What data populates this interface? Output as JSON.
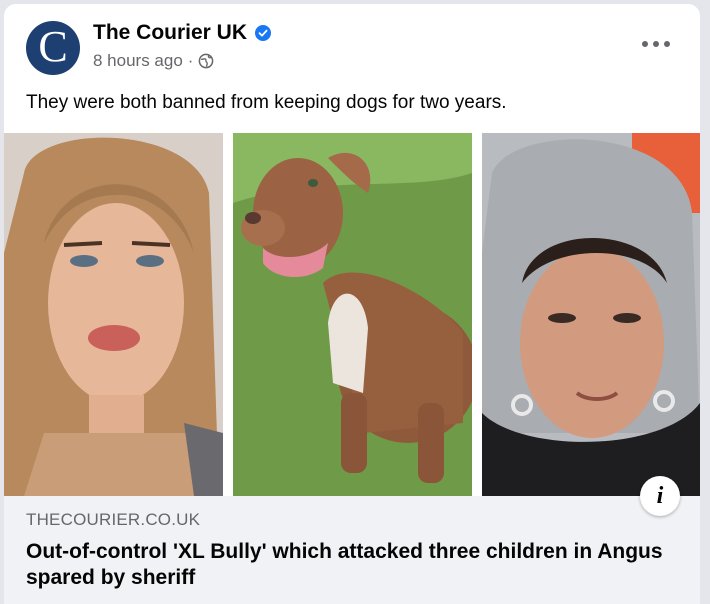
{
  "post": {
    "page_name": "The Courier UK",
    "avatar_letter": "C",
    "verified": true,
    "time": "8 hours ago",
    "separator": "·",
    "audience_icon": "globe-icon",
    "more_icon": "more-options-icon",
    "caption": "They were both banned from keeping dogs for two years."
  },
  "images": [
    {
      "name": "photo-woman"
    },
    {
      "name": "photo-dog"
    },
    {
      "name": "photo-man-hoodie"
    }
  ],
  "link": {
    "domain": "THECOURIER.CO.UK",
    "headline": "Out-of-control 'XL Bully' which attacked three children in Angus spared by sheriff",
    "info_label": "i"
  },
  "colors": {
    "avatar_bg": "#1d3f72",
    "verified_blue": "#1877f2",
    "link_bg": "#f0f2f5",
    "meta_gray": "#65676b"
  }
}
